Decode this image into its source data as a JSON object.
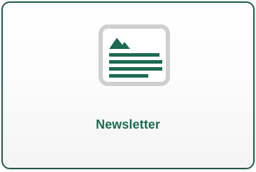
{
  "card": {
    "label": "Newsletter",
    "icon": "newsletter-icon",
    "colors": {
      "border": "#1f5a46",
      "accent": "#1d6a52",
      "icon_frame": "#cfcfcf"
    }
  }
}
